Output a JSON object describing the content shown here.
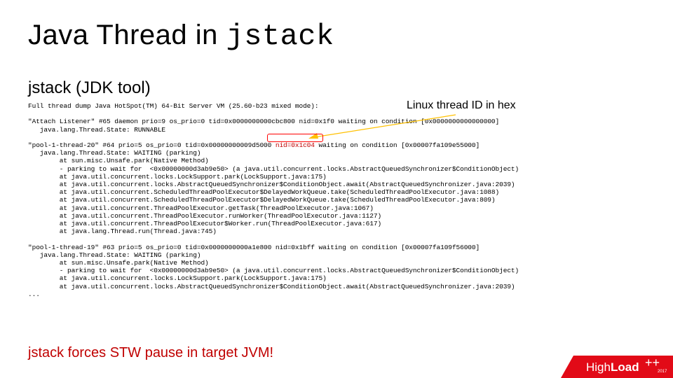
{
  "title": {
    "prefix": "Java Thread in ",
    "mono": "jstack"
  },
  "subtitle": "jstack (JDK tool)",
  "callout": "Linux thread ID in hex",
  "dump": {
    "l01": "Full thread dump Java HotSpot(TM) 64-Bit Server VM (25.60-b23 mixed mode):",
    "l02": "",
    "l03a": "\"Attach Listener\" #65 daemon prio=9 os_prio=0 tid=0x0000000000cbc800 ",
    "l03_nid": "nid=0x1f0",
    "l03b": " waiting on condition [0x0000000000000000]",
    "l04": "   java.lang.Thread.State: RUNNABLE",
    "l05": "",
    "l06a": "\"pool-1-thread-20\" #64 prio=5 os_prio=0 tid=0x00000000009d5000 ",
    "l06_nid": "nid=0x1c04",
    "l06b": " waiting on condition [0x00007fa109e55000]",
    "l07": "   java.lang.Thread.State: WAITING (parking)",
    "l08": "        at sun.misc.Unsafe.park(Native Method)",
    "l09": "        - parking to wait for  <0x00000000d3ab9e50> (a java.util.concurrent.locks.AbstractQueuedSynchronizer$ConditionObject)",
    "l10": "        at java.util.concurrent.locks.LockSupport.park(LockSupport.java:175)",
    "l11": "        at java.util.concurrent.locks.AbstractQueuedSynchronizer$ConditionObject.await(AbstractQueuedSynchronizer.java:2039)",
    "l12": "        at java.util.concurrent.ScheduledThreadPoolExecutor$DelayedWorkQueue.take(ScheduledThreadPoolExecutor.java:1088)",
    "l13": "        at java.util.concurrent.ScheduledThreadPoolExecutor$DelayedWorkQueue.take(ScheduledThreadPoolExecutor.java:809)",
    "l14": "        at java.util.concurrent.ThreadPoolExecutor.getTask(ThreadPoolExecutor.java:1067)",
    "l15": "        at java.util.concurrent.ThreadPoolExecutor.runWorker(ThreadPoolExecutor.java:1127)",
    "l16": "        at java.util.concurrent.ThreadPoolExecutor$Worker.run(ThreadPoolExecutor.java:617)",
    "l17": "        at java.lang.Thread.run(Thread.java:745)",
    "l18": "",
    "l19": "\"pool-1-thread-19\" #63 prio=5 os_prio=0 tid=0x0000000000a1e800 nid=0x1bff waiting on condition [0x00007fa109f56000]",
    "l20": "   java.lang.Thread.State: WAITING (parking)",
    "l21": "        at sun.misc.Unsafe.park(Native Method)",
    "l22": "        - parking to wait for  <0x00000000d3ab9e50> (a java.util.concurrent.locks.AbstractQueuedSynchronizer$ConditionObject)",
    "l23": "        at java.util.concurrent.locks.LockSupport.park(LockSupport.java:175)",
    "l24": "        at java.util.concurrent.locks.AbstractQueuedSynchronizer$ConditionObject.await(AbstractQueuedSynchronizer.java:2039)",
    "l25": "..."
  },
  "footer_warn": "jstack forces STW pause in target JVM!",
  "logo": {
    "brand1": "High",
    "brand2": "Load",
    "plus": "++",
    "year": "2017"
  }
}
